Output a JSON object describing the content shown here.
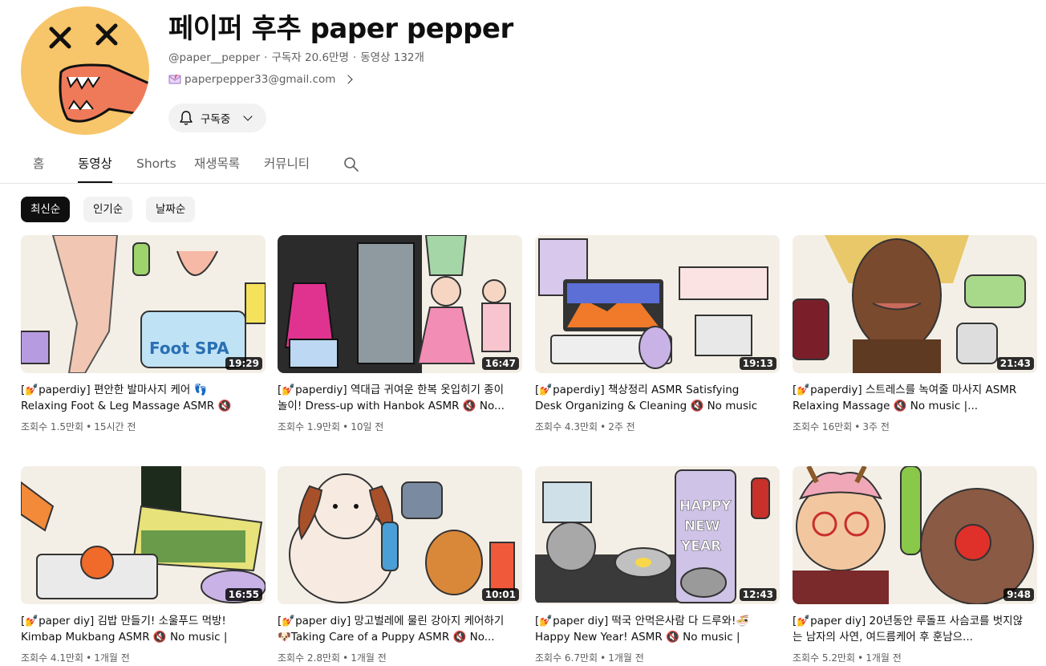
{
  "channel": {
    "title": "페이퍼 후추 paper pepper",
    "handle": "@paper__pepper",
    "subscribers": "구독자 20.6만명",
    "video_count": "동영상 132개",
    "email": "paperpepper33@gmail.com",
    "subscribe_label": "구독중"
  },
  "tabs": [
    "홈",
    "동영상",
    "Shorts",
    "재생목록",
    "커뮤니티"
  ],
  "chips": [
    "최신순",
    "인기순",
    "날짜순"
  ],
  "videos": [
    {
      "title": "[💅paperdiy] 편안한 발마사지 케어 👣 Relaxing Foot & Leg Massage ASMR 🔇 No...",
      "views": "조회수 1.5만회",
      "age": "15시간 전",
      "duration": "19:29"
    },
    {
      "title": "[💅paperdiy] 역대급 귀여운 한복 옷입히기 종이놀이! Dress-up with Hanbok ASMR 🔇 No...",
      "views": "조회수 1.9만회",
      "age": "10일 전",
      "duration": "16:47"
    },
    {
      "title": "[💅paperdiy] 책상정리 ASMR Satisfying Desk Organizing & Cleaning 🔇 No music |...",
      "views": "조회수 4.3만회",
      "age": "2주 전",
      "duration": "19:13"
    },
    {
      "title": "[💅paperdiy] 스트레스를 녹여줄 마사지 ASMR Relaxing Massage 🔇 No music |...",
      "views": "조회수 16만회",
      "age": "3주 전",
      "duration": "21:43"
    },
    {
      "title": "[💅paper diy] 김밥 만들기! 소울푸드 먹방! Kimbap Mukbang ASMR 🔇 No music | pap...",
      "views": "조회수 4.1만회",
      "age": "1개월 전",
      "duration": "16:55"
    },
    {
      "title": "[💅paper diy] 망고벌레에 물린 강아지 케어하기🐶Taking Care of a Puppy ASMR 🔇 No...",
      "views": "조회수 2.8만회",
      "age": "1개월 전",
      "duration": "10:01"
    },
    {
      "title": "[💅paper diy] 떡국 안먹은사람 다 드루와!🍜 Happy New Year! ASMR 🔇 No music | pap...",
      "views": "조회수 6.7만회",
      "age": "1개월 전",
      "duration": "12:43"
    },
    {
      "title": "[💅paper diy] 20년동안 루돌프 사슴코를 벗지않는 남자의 사연, 여드름케어 후 훈남으...",
      "views": "조회수 5.2만회",
      "age": "1개월 전",
      "duration": "9:48"
    }
  ],
  "colors": {
    "active_chip_bg": "#0f0f0f",
    "secondary_text": "#606060",
    "avatar_bg": "#f7c56a"
  }
}
